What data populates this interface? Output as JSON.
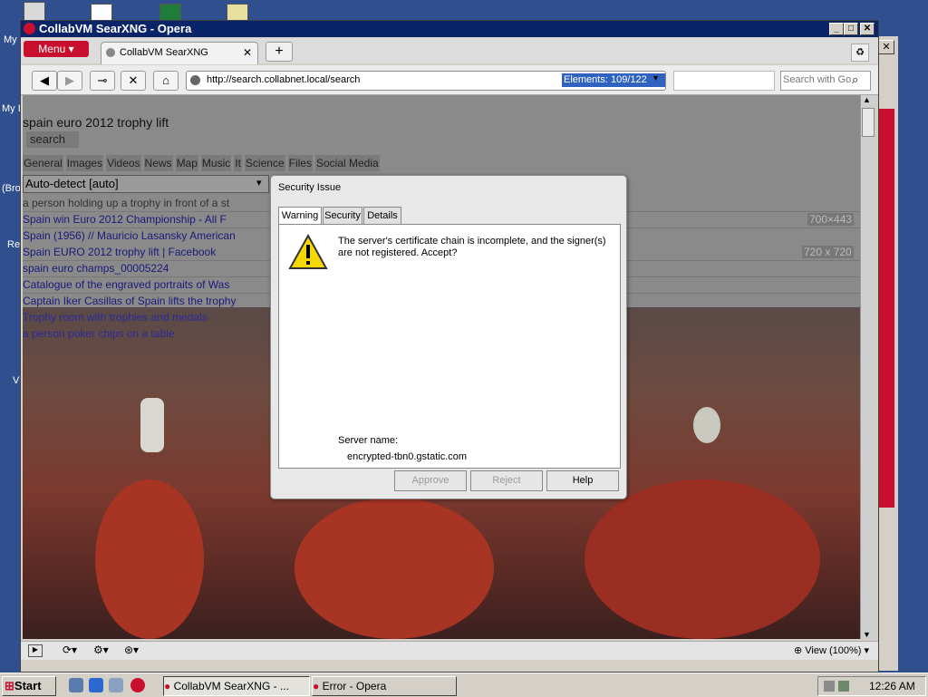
{
  "desktop": {
    "labels": [
      "My",
      "My I",
      "(Bro",
      "Re",
      "V"
    ]
  },
  "window": {
    "title": "CollabVM SearXNG - Opera",
    "menu_label": "Menu",
    "tab_label": "CollabVM SearXNG",
    "url": "http://search.collabnet.local/search",
    "elements_counter": "Elements:   109/122",
    "search_placeholder": "Search with Go",
    "zoom_label": "View (100%)"
  },
  "page": {
    "query": "spain euro 2012 trophy lift",
    "search_button": "search",
    "categories": [
      "General",
      "Images",
      "Videos",
      "News",
      "Map",
      "Music",
      "It",
      "Science",
      "Files",
      "Social Media"
    ],
    "language_select": "Auto-detect [auto]",
    "results": [
      "a person holding up a trophy in front of a st",
      "Spain win Euro 2012 Championship - All F",
      "Spain (1956) // Mauricio Lasansky American",
      "Spain EURO 2012 trophy lift | Facebook",
      "spain euro champs_00005224",
      "Catalogue of the engraved portraits of Was",
      "Captain Iker Casillas of Spain lifts the trophy",
      "Trophy room with trophies and medals",
      "a person poker chips on a table"
    ],
    "dims": [
      "700×443",
      "720 x 720"
    ]
  },
  "dialog": {
    "title": "Security Issue",
    "tabs": [
      "Warning",
      "Security",
      "Details"
    ],
    "message": "The server's certificate chain is incomplete, and the signer(s) are not registered. Accept?",
    "server_name_label": "Server name:",
    "server_host": "encrypted-tbn0.gstatic.com",
    "buttons": {
      "approve": "Approve",
      "reject": "Reject",
      "help": "Help"
    }
  },
  "taskbar": {
    "start": "Start",
    "tasks": [
      "CollabVM SearXNG - ...",
      "Error - Opera"
    ],
    "clock": "12:26 AM"
  },
  "colors": {
    "titlebar": "#0a246a",
    "opera_red": "#c8102e",
    "desktop": "#2f4f8f"
  }
}
